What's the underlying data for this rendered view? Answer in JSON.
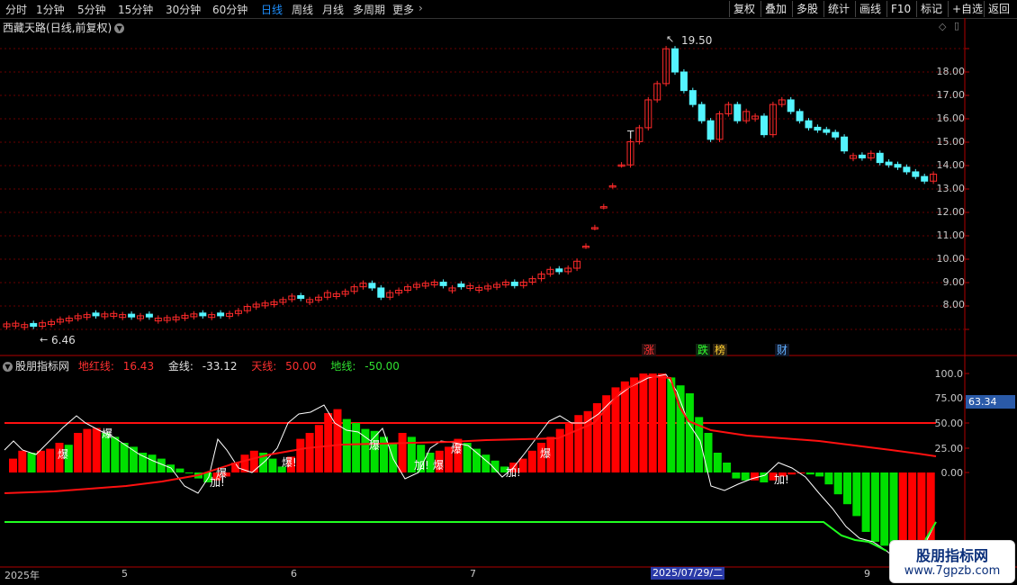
{
  "toolbar": {
    "periods": [
      "分时",
      "1分钟",
      "5分钟",
      "15分钟",
      "30分钟",
      "60分钟",
      "日线",
      "周线",
      "月线",
      "多周期",
      "更多"
    ],
    "active_period": "日线",
    "buttons": [
      "复权",
      "叠加",
      "多股",
      "统计",
      "画线",
      "F10",
      "标记",
      "+自选",
      "返回"
    ]
  },
  "stock": {
    "name": "西藏天路",
    "mode": "(日线,前复权)",
    "high_label": "19.50",
    "low_label": "6.46",
    "t_label": "T"
  },
  "price_axis": [
    "18.00",
    "17.00",
    "16.00",
    "15.00",
    "14.00",
    "13.00",
    "12.00",
    "11.00",
    "10.00",
    "9.00",
    "8.00"
  ],
  "tags": {
    "zhang": "涨",
    "die": "跌",
    "bang": "榜",
    "cai": "财"
  },
  "indicator": {
    "name": "股朋指标网",
    "dhx_label": "地红线:",
    "dhx_value": "16.43",
    "jx_label": "金线:",
    "jx_value": "-33.12",
    "tx_label": "天线:",
    "tx_value": "50.00",
    "dx_label": "地线:",
    "dx_value": "-50.00",
    "current_value": "63.34",
    "axis": [
      "100.0",
      "75.00",
      "50.00",
      "25.00",
      "0.00"
    ],
    "signals": {
      "bao": "爆",
      "jia": "加!",
      "baox": "爆!"
    }
  },
  "dates": {
    "year": "2025年",
    "m5": "5",
    "m6": "6",
    "m7": "7",
    "cursor": "2025/07/29/二",
    "m9": "9"
  },
  "watermark": {
    "title": "股朋指标网",
    "url": "www.7gpzb.com"
  },
  "colors": {
    "up": "#ff2a2a",
    "down": "#54f4ff",
    "green": "#00e000",
    "red": "#ff0000",
    "gold": "#ffffff"
  }
}
